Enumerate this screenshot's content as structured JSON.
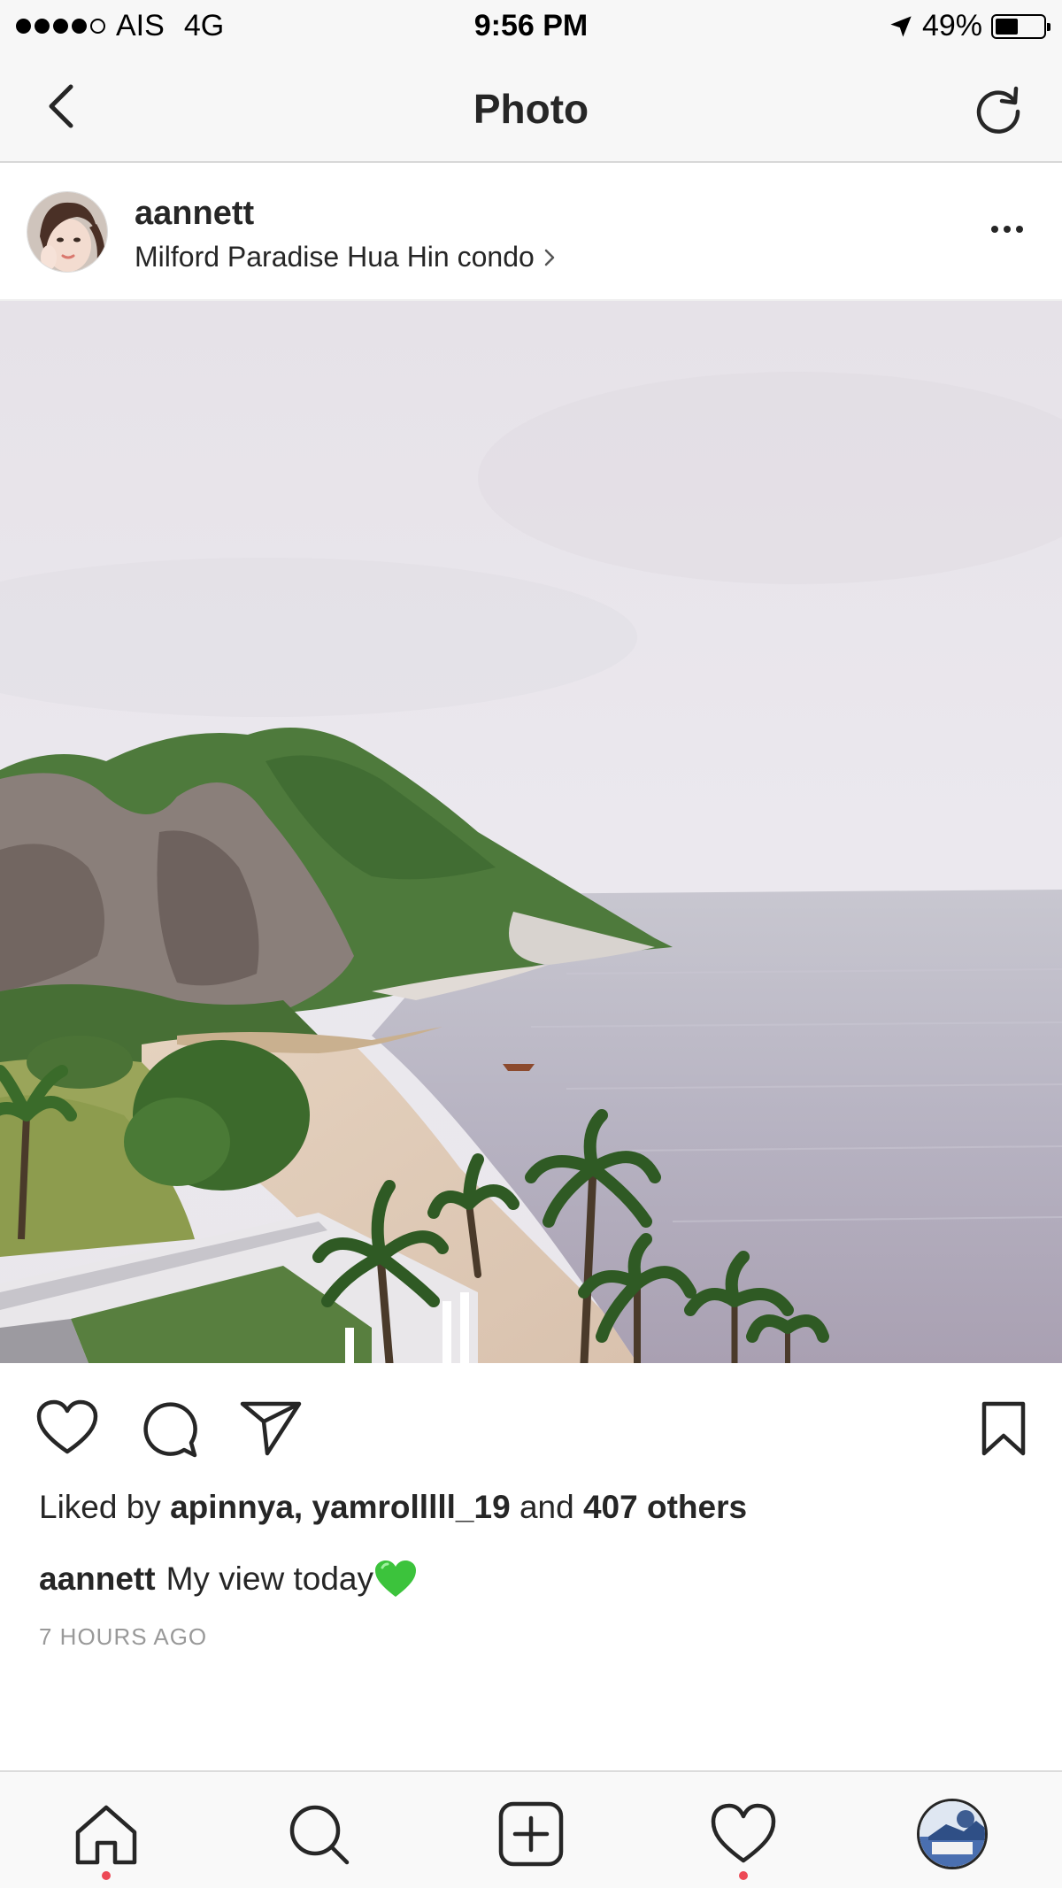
{
  "status_bar": {
    "carrier": "AIS",
    "network": "4G",
    "time": "9:56 PM",
    "battery_percent": "49%",
    "battery_level": 0.49,
    "signal_bars": 4,
    "signal_total": 5
  },
  "nav": {
    "title": "Photo",
    "back_icon": "chevron-left-icon",
    "refresh_icon": "refresh-icon"
  },
  "post": {
    "username": "aannett",
    "location": "Milford Paradise Hua Hin condo",
    "likes": {
      "prefix": "Liked by",
      "users": "apinnya, yamrolllll_19",
      "conjunction": "and",
      "others": "407 others"
    },
    "caption": {
      "username": "aannett",
      "text": "My view today",
      "emoji": "💚"
    },
    "timestamp": "7 HOURS AGO"
  },
  "actions": {
    "like_icon": "heart-icon",
    "comment_icon": "comment-icon",
    "share_icon": "send-icon",
    "save_icon": "bookmark-icon"
  },
  "tabbar": {
    "items": [
      {
        "icon": "home-icon",
        "notification": true
      },
      {
        "icon": "search-icon",
        "notification": false
      },
      {
        "icon": "add-post-icon",
        "notification": false
      },
      {
        "icon": "activity-heart-icon",
        "notification": true
      },
      {
        "icon": "profile-avatar-icon",
        "notification": false
      }
    ]
  },
  "colors": {
    "text": "#262626",
    "muted": "#999999",
    "notification_dot": "#ed4956",
    "emoji_heart": "#3cc33c"
  }
}
